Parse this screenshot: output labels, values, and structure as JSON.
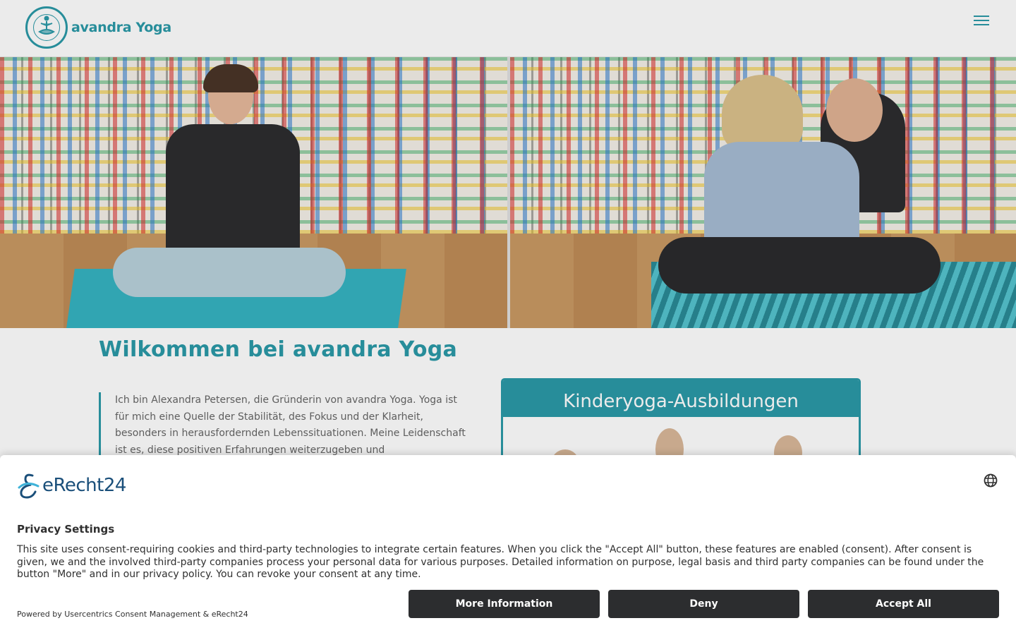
{
  "header": {
    "brand": "avandra Yoga"
  },
  "main": {
    "welcome_title": "Wilkommen bei avandra Yoga",
    "intro_text": "Ich bin Alexandra Petersen, die Gründerin von avandra Yoga. Yoga ist für mich eine Quelle der Stabilität, des Fokus und der Klarheit, besonders in herausfordernden Lebenssituationen. Meine Leidenschaft ist es, diese positiven Erfahrungen weiterzugeben und",
    "card_title": "Kinderyoga-Ausbildungen"
  },
  "consent": {
    "brand": "eRecht24",
    "title": "Privacy Settings",
    "text": "This site uses consent-requiring cookies and third-party technologies to integrate certain features. When you click the \"Accept All\" button, these features are enabled (consent). After consent is given, we and the involved third-party companies process your personal data for various purposes. Detailed information on purpose, legal basis and third party companies can be found under the button \"More\" and in our privacy policy. You can revoke your consent at any time.",
    "powered_by": "Powered by Usercentrics Consent Management & eRecht24",
    "more_label": "More Information",
    "deny_label": "Deny",
    "accept_label": "Accept All"
  },
  "colors": {
    "accent": "#2b9aa8",
    "button_bg": "#2c2d2f",
    "text": "#303030"
  },
  "icons": [
    "yoga-lotus-logo-icon",
    "hamburger-menu-icon",
    "globe-icon",
    "erecht24-logo-icon"
  ]
}
